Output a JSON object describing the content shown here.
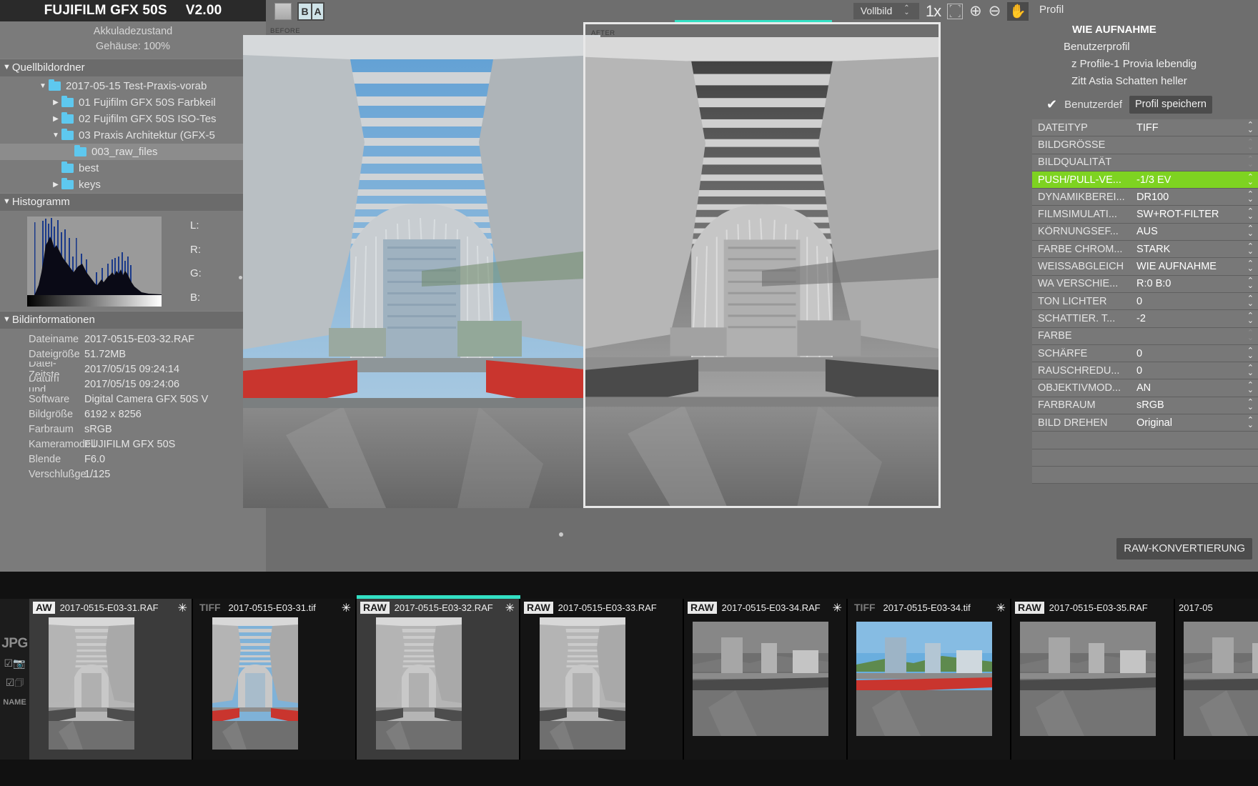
{
  "app": {
    "title": "FUJIFILM GFX 50S",
    "version": "V2.00"
  },
  "battery": {
    "label": "Akkuladezustand",
    "body": "Gehäuse: 100%"
  },
  "source_folder": {
    "header": "Quellbildordner",
    "items": [
      {
        "label": "2017-05-15 Test-Praxis-vorab",
        "indent": 1,
        "arrow": "▼",
        "selected": false
      },
      {
        "label": "01 Fujifilm GFX 50S Farbkeil",
        "indent": 2,
        "arrow": "▶",
        "selected": false
      },
      {
        "label": "02 Fujifilm GFX 50S ISO-Tes",
        "indent": 2,
        "arrow": "▶",
        "selected": false
      },
      {
        "label": "03 Praxis Architektur (GFX-5",
        "indent": 2,
        "arrow": "▼",
        "selected": false
      },
      {
        "label": "003_raw_files",
        "indent": 3,
        "arrow": "",
        "selected": true
      },
      {
        "label": "best",
        "indent": 2,
        "arrow": "",
        "selected": false
      },
      {
        "label": "keys",
        "indent": 2,
        "arrow": "▶",
        "selected": false
      }
    ]
  },
  "histogram": {
    "header": "Histogramm",
    "channels": [
      {
        "label": "L:",
        "value": ""
      },
      {
        "label": "R:",
        "value": ""
      },
      {
        "label": "G:",
        "value": ""
      },
      {
        "label": "B:",
        "value": ""
      }
    ]
  },
  "image_info": {
    "header": "Bildinformationen",
    "rows": [
      {
        "key": "Dateiname",
        "value": "2017-0515-E03-32.RAF"
      },
      {
        "key": "Dateigröße",
        "value": "51.72MB"
      },
      {
        "key": "Datei-Zeitste...",
        "value": "2017/05/15 09:24:14"
      },
      {
        "key": "Datum und...",
        "value": "2017/05/15 09:24:06"
      },
      {
        "key": "Software",
        "value": "Digital Camera GFX 50S V"
      },
      {
        "key": "Bildgröße",
        "value": "6192 x 8256"
      },
      {
        "key": "Farbraum",
        "value": "sRGB"
      },
      {
        "key": "Kameramodell",
        "value": "FUJIFILM GFX 50S"
      },
      {
        "key": "Blende",
        "value": "F6.0"
      },
      {
        "key": "Verschlußge...",
        "value": "1/125"
      }
    ]
  },
  "viewer": {
    "ba_before": "B",
    "ba_after": "A",
    "before_label": "BEFORE",
    "after_label": "AFTER",
    "view_mode": "Vollbild",
    "zoom_level": "1x",
    "icons": {
      "fit": "fit-screen-icon",
      "zoom_in": "zoom-in-icon",
      "zoom_out": "zoom-out-icon",
      "hand": "hand-tool-icon"
    }
  },
  "profile": {
    "header": "Profil",
    "items": [
      {
        "label": "WIE AUFNAHME",
        "level": 1,
        "bold": true
      },
      {
        "label": "Benutzerprofil",
        "level": 2,
        "bold": false
      },
      {
        "label": "z Profile-1 Provia lebendig",
        "level": 3,
        "bold": false
      },
      {
        "label": "Zitt Astia Schatten heller",
        "level": 3,
        "bold": false
      }
    ],
    "user_profile_label": "Benutzerdef",
    "save_button": "Profil speichern",
    "check_icon": "checkmark-icon"
  },
  "settings": {
    "rows": [
      {
        "key": "DATEITYP",
        "value": "TIFF",
        "highlight": false,
        "enabled": true
      },
      {
        "key": "BILDGRÖSSE",
        "value": "",
        "highlight": false,
        "enabled": false
      },
      {
        "key": "BILDQUALITÄT",
        "value": "",
        "highlight": false,
        "enabled": false
      },
      {
        "key": "PUSH/PULL-VE...",
        "value": "-1/3 EV",
        "highlight": true,
        "enabled": true
      },
      {
        "key": "DYNAMIKBEREI...",
        "value": "DR100",
        "highlight": false,
        "enabled": true
      },
      {
        "key": "FILMSIMULATI...",
        "value": "SW+ROT-FILTER",
        "highlight": false,
        "enabled": true
      },
      {
        "key": "KÖRNUNGSEF...",
        "value": "AUS",
        "highlight": false,
        "enabled": true
      },
      {
        "key": "FARBE CHROM...",
        "value": "STARK",
        "highlight": false,
        "enabled": true
      },
      {
        "key": "WEISSABGLEICH",
        "value": "WIE AUFNAHME",
        "highlight": false,
        "enabled": true
      },
      {
        "key": "WA VERSCHIE...",
        "value": "R:0 B:0",
        "highlight": false,
        "enabled": true
      },
      {
        "key": "TON LICHTER",
        "value": "0",
        "highlight": false,
        "enabled": true
      },
      {
        "key": "SCHATTIER. T...",
        "value": "-2",
        "highlight": false,
        "enabled": true
      },
      {
        "key": "FARBE",
        "value": "",
        "highlight": false,
        "enabled": false
      },
      {
        "key": "SCHÄRFE",
        "value": "0",
        "highlight": false,
        "enabled": true
      },
      {
        "key": "RAUSCHREDU...",
        "value": "0",
        "highlight": false,
        "enabled": true
      },
      {
        "key": "OBJEKTIVMOD...",
        "value": "AN",
        "highlight": false,
        "enabled": true
      },
      {
        "key": "FARBRAUM",
        "value": "sRGB",
        "highlight": false,
        "enabled": true
      },
      {
        "key": "BILD DREHEN",
        "value": "Original",
        "highlight": false,
        "enabled": true
      }
    ],
    "convert_button": "RAW-KONVERTIERUNG"
  },
  "filmstrip": {
    "rail": {
      "jpg": "JPG",
      "name": "NAME",
      "camera_icon": "camera-checkbox-icon",
      "copy_icon": "copy-checkbox-icon"
    },
    "items": [
      {
        "badge": "AW",
        "name": "2017-0515-E03-31.RAF",
        "selected": false,
        "alt": true,
        "variant": "tunnel-bw",
        "star": true
      },
      {
        "badge": "TIFF",
        "name": "2017-0515-E03-31.tif",
        "selected": false,
        "alt": false,
        "variant": "tunnel-color",
        "star": true
      },
      {
        "badge": "RAW",
        "name": "2017-0515-E03-32.RAF",
        "selected": true,
        "alt": true,
        "variant": "tunnel-bw",
        "star": true
      },
      {
        "badge": "RAW",
        "name": "2017-0515-E03-33.RAF",
        "selected": false,
        "alt": false,
        "variant": "tunnel-bw",
        "star": false
      },
      {
        "badge": "RAW",
        "name": "2017-0515-E03-34.RAF",
        "selected": false,
        "alt": false,
        "variant": "city-bw",
        "star": true
      },
      {
        "badge": "TIFF",
        "name": "2017-0515-E03-34.tif",
        "selected": false,
        "alt": false,
        "variant": "city-color",
        "star": true
      },
      {
        "badge": "RAW",
        "name": "2017-0515-E03-35.RAF",
        "selected": false,
        "alt": false,
        "variant": "city-bw",
        "star": false
      },
      {
        "badge": "",
        "name": "2017-05",
        "selected": false,
        "alt": false,
        "variant": "city-bw",
        "star": false
      }
    ]
  },
  "colors": {
    "accent_teal": "#32e0c4",
    "highlight_green": "#7ed321",
    "panel_gray": "#6e6e6e",
    "folder_blue": "#5ec8ef"
  }
}
